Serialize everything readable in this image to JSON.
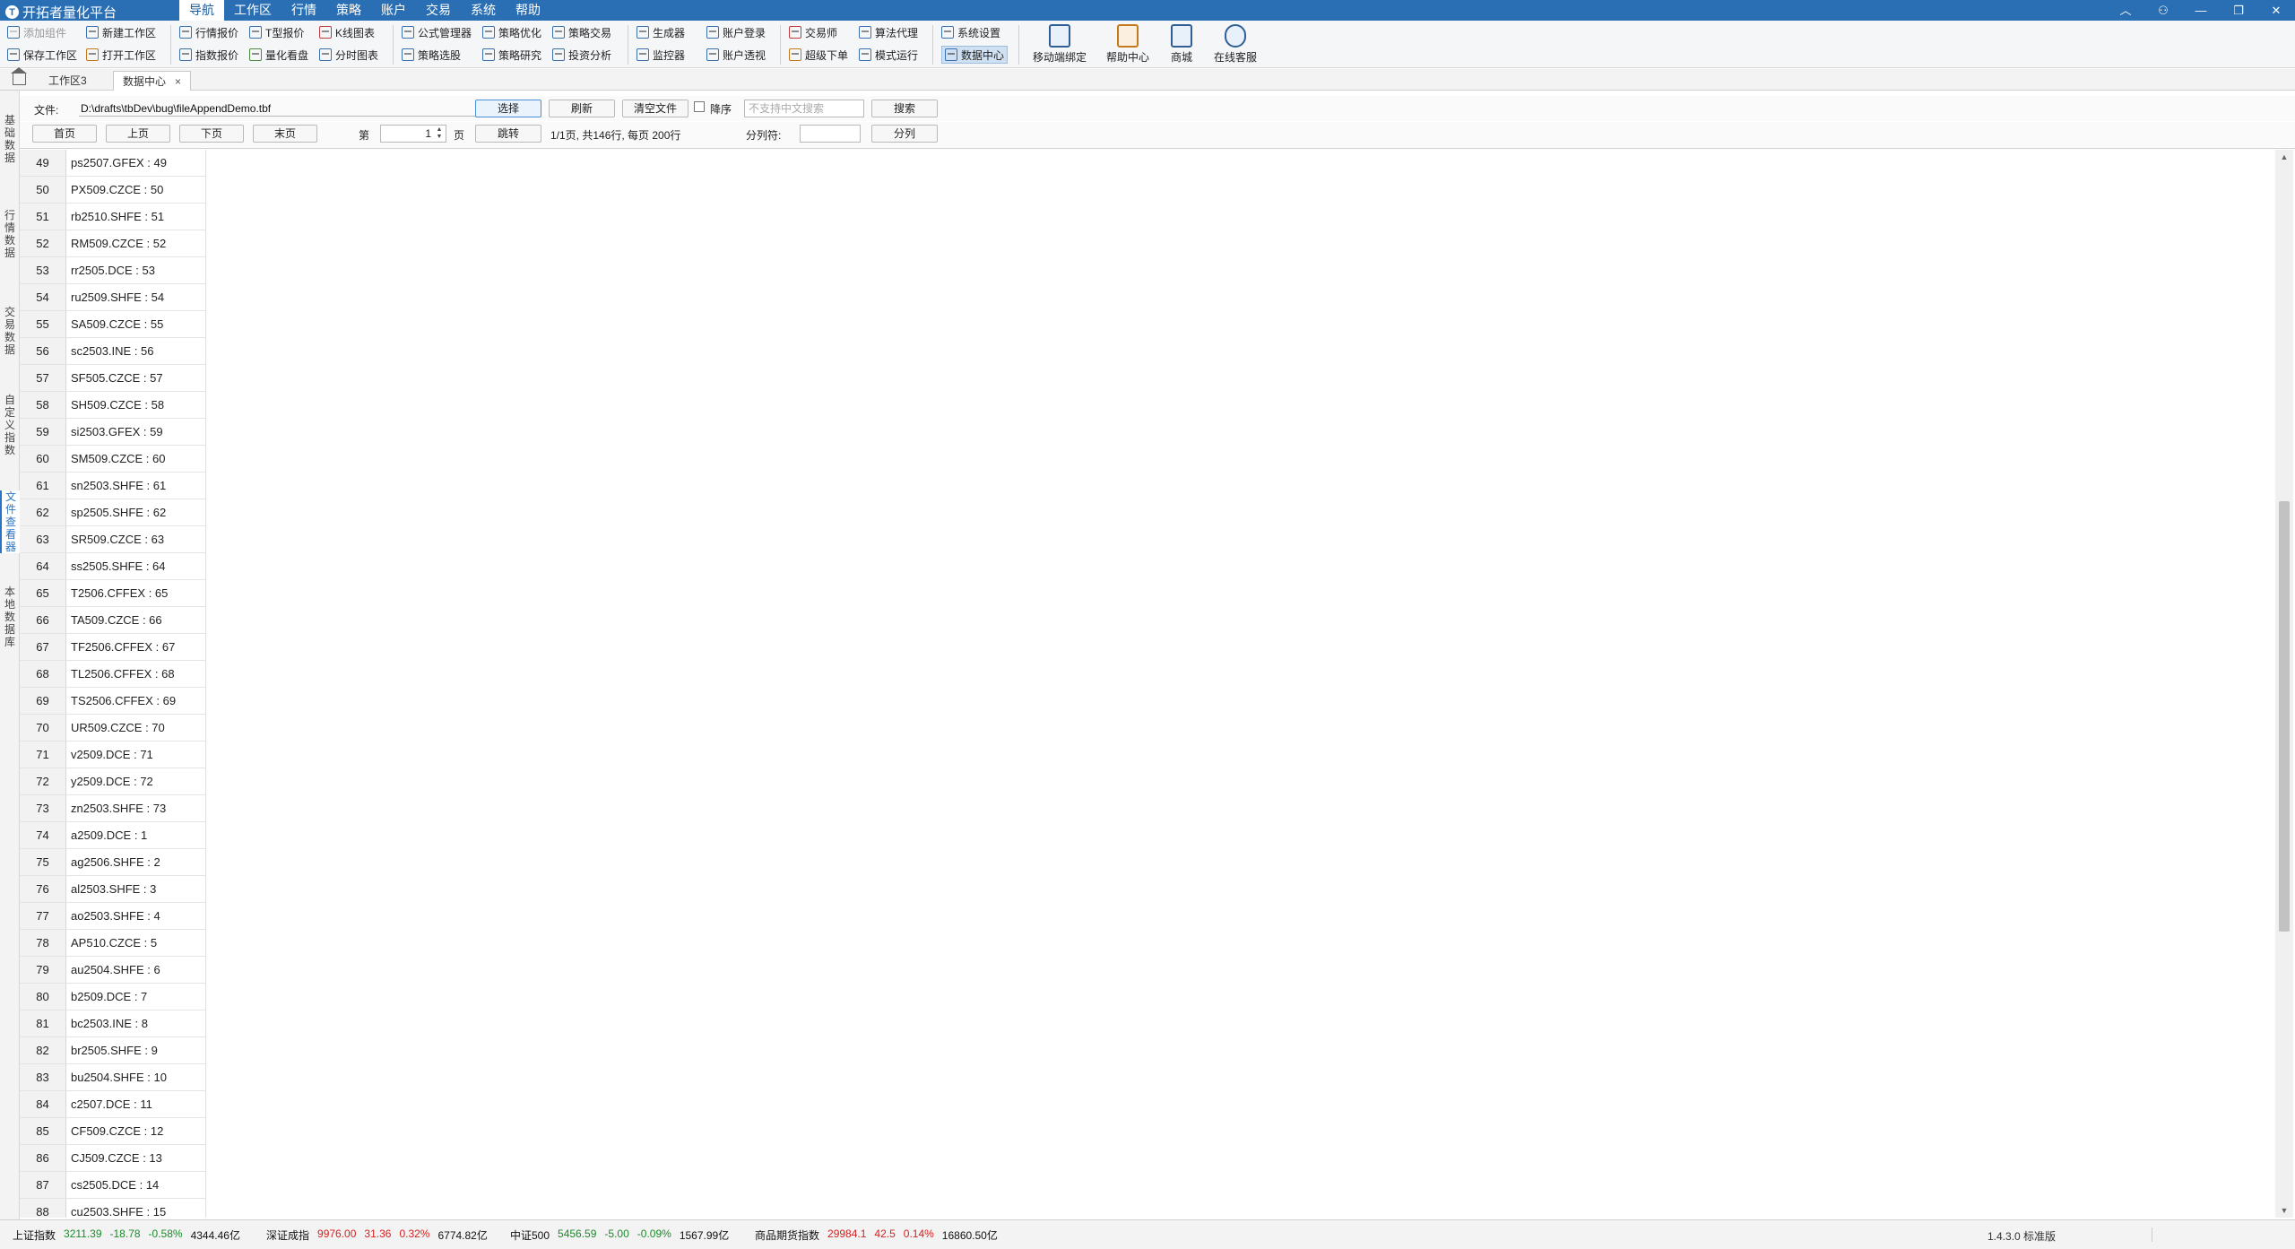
{
  "titlebar": {
    "app_title": "开拓者量化平台",
    "menu": [
      "导航",
      "工作区",
      "行情",
      "策略",
      "账户",
      "交易",
      "系统",
      "帮助"
    ],
    "active_menu_index": 0
  },
  "ribbon": {
    "group1": [
      "添加组件",
      "保存工作区"
    ],
    "group2": [
      "新建工作区",
      "打开工作区"
    ],
    "group3": [
      "行情报价",
      "指数报价"
    ],
    "group4": [
      "T型报价",
      "量化看盘"
    ],
    "group5": [
      "K线图表",
      "分时图表"
    ],
    "group6": [
      "公式管理器",
      "策略选股"
    ],
    "group7": [
      "策略优化",
      "策略研究"
    ],
    "group8": [
      "策略交易",
      "投资分析"
    ],
    "group9": [
      "生成器",
      "监控器"
    ],
    "group10": [
      "账户登录",
      "账户透视"
    ],
    "group11": [
      "交易师",
      "超级下单"
    ],
    "group12": [
      "算法代理",
      "模式运行"
    ],
    "group13": [
      "系统设置",
      "数据中心"
    ],
    "big": [
      "移动端绑定",
      "帮助中心",
      "商城",
      "在线客服"
    ]
  },
  "tabs": {
    "tab1": "工作区3",
    "tab2": "数据中心",
    "close": "×"
  },
  "side_tabs": [
    "基础数据",
    "行情数据",
    "交易数据",
    "自定义指数",
    "文件查看器",
    "本地数据库"
  ],
  "toolbar": {
    "file_label": "文件:",
    "file_path": "D:\\drafts\\tbDev\\bug\\fileAppendDemo.tbf",
    "select_btn": "选择",
    "refresh_btn": "刷新",
    "clear_btn": "清空文件",
    "desc_label": "降序",
    "search_placeholder": "不支持中文搜索",
    "search_btn": "搜索",
    "first_btn": "首页",
    "prev_btn": "上页",
    "next_btn": "下页",
    "last_btn": "末页",
    "page_prefix": "第",
    "page_value": "1",
    "page_suffix": "页",
    "jump_btn": "跳转",
    "page_info": "1/1页, 共146行, 每页 200行",
    "sep_label": "分列符:",
    "split_btn": "分列"
  },
  "rows": [
    {
      "n": "49",
      "v": "ps2507.GFEX : 49"
    },
    {
      "n": "50",
      "v": "PX509.CZCE : 50"
    },
    {
      "n": "51",
      "v": "rb2510.SHFE : 51"
    },
    {
      "n": "52",
      "v": "RM509.CZCE : 52"
    },
    {
      "n": "53",
      "v": "rr2505.DCE : 53"
    },
    {
      "n": "54",
      "v": "ru2509.SHFE : 54"
    },
    {
      "n": "55",
      "v": "SA509.CZCE : 55"
    },
    {
      "n": "56",
      "v": "sc2503.INE : 56"
    },
    {
      "n": "57",
      "v": "SF505.CZCE : 57"
    },
    {
      "n": "58",
      "v": "SH509.CZCE : 58"
    },
    {
      "n": "59",
      "v": "si2503.GFEX : 59"
    },
    {
      "n": "60",
      "v": "SM509.CZCE : 60"
    },
    {
      "n": "61",
      "v": "sn2503.SHFE : 61"
    },
    {
      "n": "62",
      "v": "sp2505.SHFE : 62"
    },
    {
      "n": "63",
      "v": "SR509.CZCE : 63"
    },
    {
      "n": "64",
      "v": "ss2505.SHFE : 64"
    },
    {
      "n": "65",
      "v": "T2506.CFFEX : 65"
    },
    {
      "n": "66",
      "v": "TA509.CZCE : 66"
    },
    {
      "n": "67",
      "v": "TF2506.CFFEX : 67"
    },
    {
      "n": "68",
      "v": "TL2506.CFFEX : 68"
    },
    {
      "n": "69",
      "v": "TS2506.CFFEX : 69"
    },
    {
      "n": "70",
      "v": "UR509.CZCE : 70"
    },
    {
      "n": "71",
      "v": "v2509.DCE : 71"
    },
    {
      "n": "72",
      "v": "y2509.DCE : 72"
    },
    {
      "n": "73",
      "v": "zn2503.SHFE : 73"
    },
    {
      "n": "74",
      "v": "a2509.DCE : 1"
    },
    {
      "n": "75",
      "v": "ag2506.SHFE : 2"
    },
    {
      "n": "76",
      "v": "al2503.SHFE : 3"
    },
    {
      "n": "77",
      "v": "ao2503.SHFE : 4"
    },
    {
      "n": "78",
      "v": "AP510.CZCE : 5"
    },
    {
      "n": "79",
      "v": "au2504.SHFE : 6"
    },
    {
      "n": "80",
      "v": "b2509.DCE : 7"
    },
    {
      "n": "81",
      "v": "bc2503.INE : 8"
    },
    {
      "n": "82",
      "v": "br2505.SHFE : 9"
    },
    {
      "n": "83",
      "v": "bu2504.SHFE : 10"
    },
    {
      "n": "84",
      "v": "c2507.DCE : 11"
    },
    {
      "n": "85",
      "v": "CF509.CZCE : 12"
    },
    {
      "n": "86",
      "v": "CJ509.CZCE : 13"
    },
    {
      "n": "87",
      "v": "cs2505.DCE : 14"
    },
    {
      "n": "88",
      "v": "cu2503.SHFE : 15"
    }
  ],
  "statusbar": {
    "indices": [
      {
        "name": "上证指数",
        "price": "3211.39",
        "chg": "-18.78",
        "pct": "-0.58%",
        "amount": "4344.46亿",
        "dir": "dn"
      },
      {
        "name": "深证成指",
        "price": "9976.00",
        "chg": "31.36",
        "pct": "0.32%",
        "amount": "6774.82亿",
        "dir": "up"
      },
      {
        "name": "中证500",
        "price": "5456.59",
        "chg": "-5.00",
        "pct": "-0.09%",
        "amount": "1567.99亿",
        "dir": "dn"
      },
      {
        "name": "商品期货指数",
        "price": "29984.1",
        "chg": "42.5",
        "pct": "0.14%",
        "amount": "16860.50亿",
        "dir": "up"
      }
    ],
    "version": "1.4.3.0 标准版"
  }
}
